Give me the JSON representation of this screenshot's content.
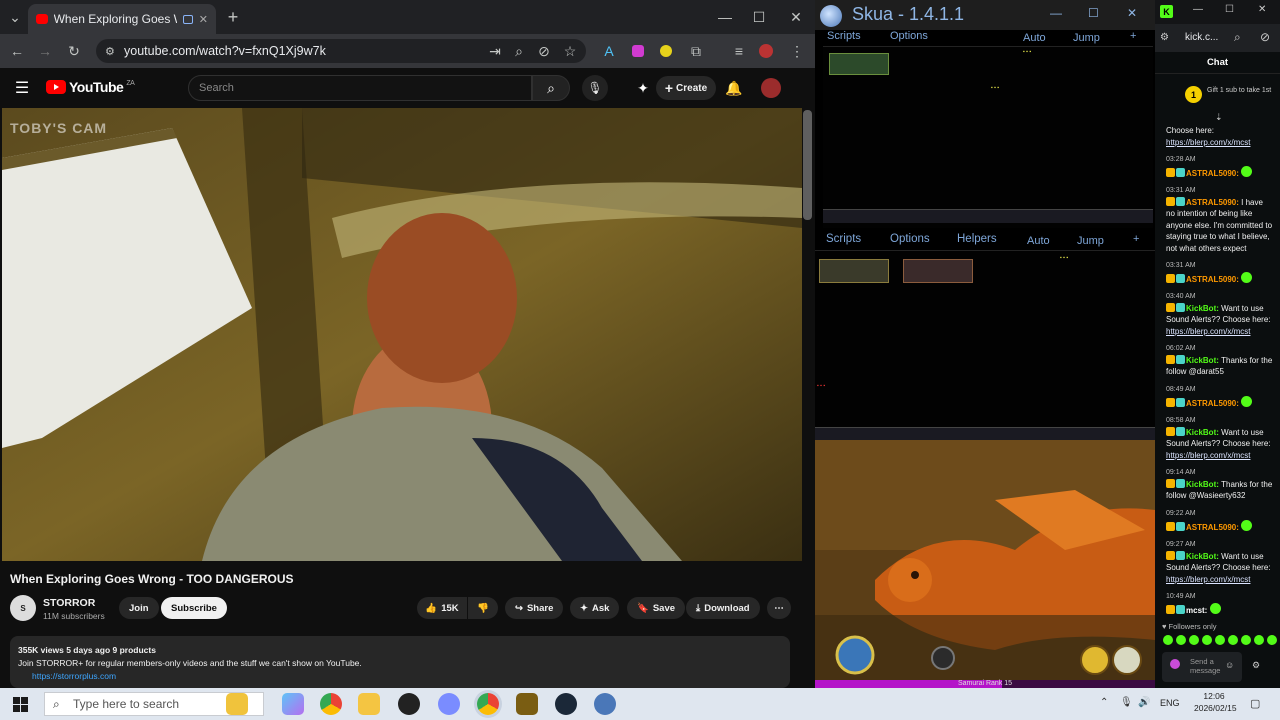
{
  "browser": {
    "tab_title": "When Exploring Goes Wron",
    "url": "youtube.com/watch?v=fxnQ1Xj9w7k",
    "new_tab_label": "+",
    "window_controls": [
      "—",
      "☐",
      "✕"
    ]
  },
  "youtube": {
    "logo_text": "YouTube",
    "logo_region": "ZA",
    "search_placeholder": "Search",
    "create_label": "Create",
    "cam_watermark": "TOBY'S CAM",
    "video_title": "When Exploring Goes Wrong - TOO DANGEROUS",
    "channel_name": "STORROR",
    "subscribers": "11M subscribers",
    "join_label": "Join",
    "subscribe_label": "Subscribe",
    "likes": "15K",
    "share_label": "Share",
    "ask_label": "Ask",
    "save_label": "Save",
    "download_label": "Download",
    "description_meta": "355K views  5 days ago  9 products",
    "description_line": "Join STORROR+ for regular members-only videos and the stuff we can't show on YouTube.",
    "description_link": "https://storrorplus.com"
  },
  "skua": {
    "title": "Skua - 1.4.1.1",
    "top_menu": [
      "Scripts",
      "Options",
      "Auto",
      "Jump"
    ],
    "second_menu": [
      "Scripts",
      "Options",
      "Helpers",
      "Auto",
      "Jump"
    ],
    "rank_text": "Samurai Rank 15",
    "rank_progress": 0.55
  },
  "kick": {
    "url": "kick.c...",
    "chat_header": "Chat",
    "gift_text": "Gift 1 sub to take 1st",
    "messages": [
      {
        "time": "",
        "user": "",
        "text": "Choose here:",
        "link": "https://blerp.com/x/mcst"
      },
      {
        "time": "03:28 AM",
        "user": "ASTRAL5090:",
        "text": "",
        "link": ""
      },
      {
        "time": "03:31 AM",
        "user": "ASTRAL5090:",
        "text": "I have no intention of being like anyone else. I'm committed to staying true to what I believe, not what others expect",
        "link": ""
      },
      {
        "time": "03:31 AM",
        "user": "ASTRAL5090:",
        "text": "",
        "link": ""
      },
      {
        "time": "03:40 AM",
        "user": "KickBot:",
        "text": "Want to use Sound Alerts?? Choose here:",
        "link": "https://blerp.com/x/mcst"
      },
      {
        "time": "06:02 AM",
        "user": "KickBot:",
        "text": "Thanks for the follow @darat55",
        "link": ""
      },
      {
        "time": "08:49 AM",
        "user": "ASTRAL5090:",
        "text": "",
        "link": ""
      },
      {
        "time": "08:58 AM",
        "user": "KickBot:",
        "text": "Want to use Sound Alerts?? Choose here:",
        "link": "https://blerp.com/x/mcst"
      },
      {
        "time": "09:14 AM",
        "user": "KickBot:",
        "text": "Thanks for the follow @Wasieerty632",
        "link": ""
      },
      {
        "time": "09:22 AM",
        "user": "ASTRAL5090:",
        "text": "",
        "link": ""
      },
      {
        "time": "09:27 AM",
        "user": "KickBot:",
        "text": "Want to use Sound Alerts?? Choose here:",
        "link": "https://blerp.com/x/mcst"
      },
      {
        "time": "10:49 AM",
        "user": "mcst:",
        "text": "",
        "link": ""
      }
    ],
    "followers_only": "Followers only",
    "send_placeholder": "Send a message"
  },
  "taskbar": {
    "search_placeholder": "Type here to search",
    "language": "ENG",
    "time": "12:06",
    "date": "2026/02/15"
  },
  "colors": {
    "youtube_red": "#ff0000",
    "kick_green": "#53fc18",
    "skua_blue": "#8fb6e5",
    "astral_name": "#ff9900",
    "kickbot_name": "#53fc18",
    "mcst_name": "#ffffff"
  }
}
